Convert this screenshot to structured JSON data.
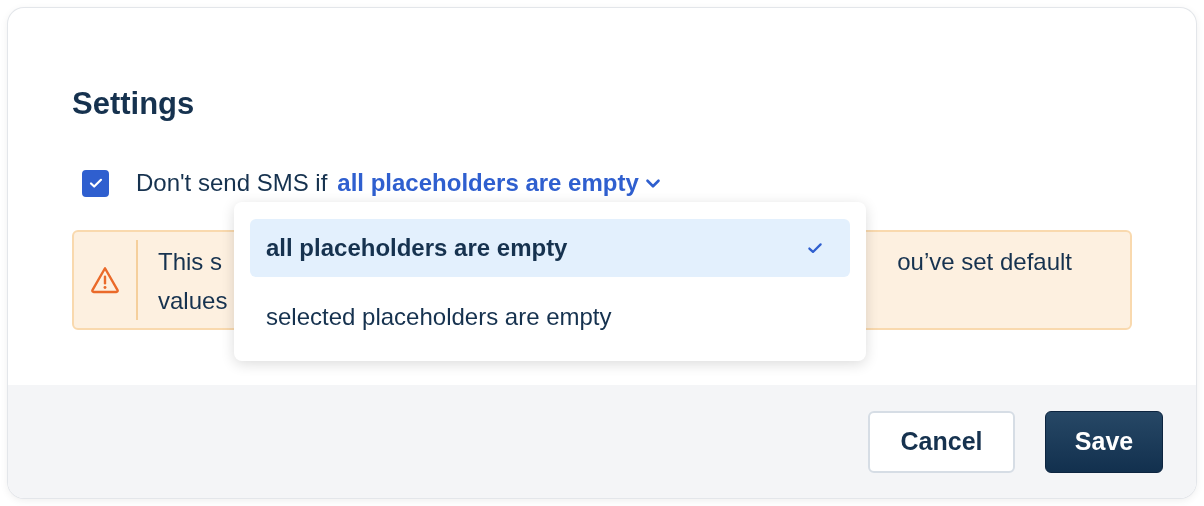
{
  "title": "Settings",
  "condition": {
    "checked": true,
    "label": "Don't send SMS if",
    "value": "all placeholders are empty",
    "expanded": true
  },
  "warning": {
    "line_1_start": "This s",
    "line_1_end": "ou’ve set default",
    "line_2": "values"
  },
  "dropdown": {
    "options": [
      {
        "label": "all placeholders are empty",
        "selected": true
      },
      {
        "label": "selected placeholders are empty",
        "selected": false
      }
    ]
  },
  "buttons": [
    {
      "label": "Cancel",
      "kind": "secondary"
    },
    {
      "label": "Save",
      "kind": "primary"
    }
  ]
}
